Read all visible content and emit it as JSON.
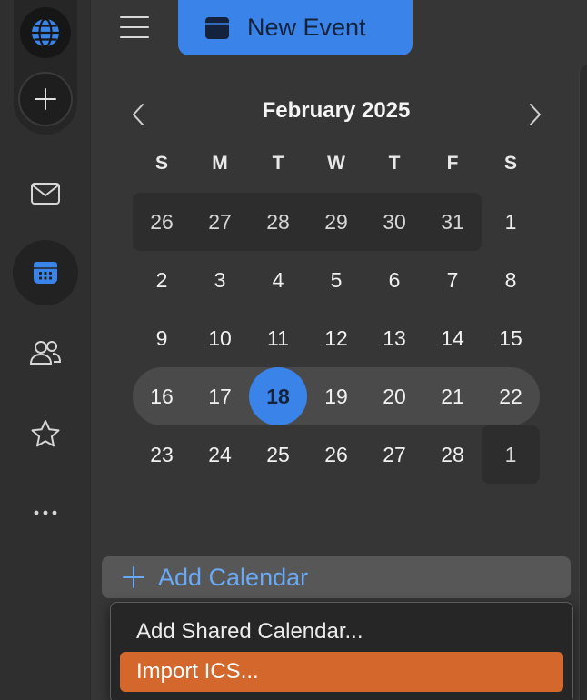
{
  "sidebar": {
    "icons": [
      "globe-icon",
      "plus-icon",
      "mail-icon",
      "calendar-icon",
      "contacts-icon",
      "star-icon",
      "more-icon"
    ],
    "active": "calendar"
  },
  "toolbar": {
    "new_event_label": "New Event"
  },
  "calendar": {
    "month_title": "February 2025",
    "weekdays": [
      "S",
      "M",
      "T",
      "W",
      "T",
      "F",
      "S"
    ],
    "weeks": [
      [
        "26",
        "27",
        "28",
        "29",
        "30",
        "31",
        "1"
      ],
      [
        "2",
        "3",
        "4",
        "5",
        "6",
        "7",
        "8"
      ],
      [
        "9",
        "10",
        "11",
        "12",
        "13",
        "14",
        "15"
      ],
      [
        "16",
        "17",
        "18",
        "19",
        "20",
        "21",
        "22"
      ],
      [
        "23",
        "24",
        "25",
        "26",
        "27",
        "28",
        "1"
      ]
    ],
    "today": "18"
  },
  "add_calendar": {
    "label": "Add Calendar"
  },
  "menu": {
    "items": [
      "Add Shared Calendar...",
      "Import ICS..."
    ],
    "selected_index": 1
  },
  "colors": {
    "accent": "#3a83e8",
    "selection": "#d4672b",
    "link": "#6aa9f5"
  }
}
